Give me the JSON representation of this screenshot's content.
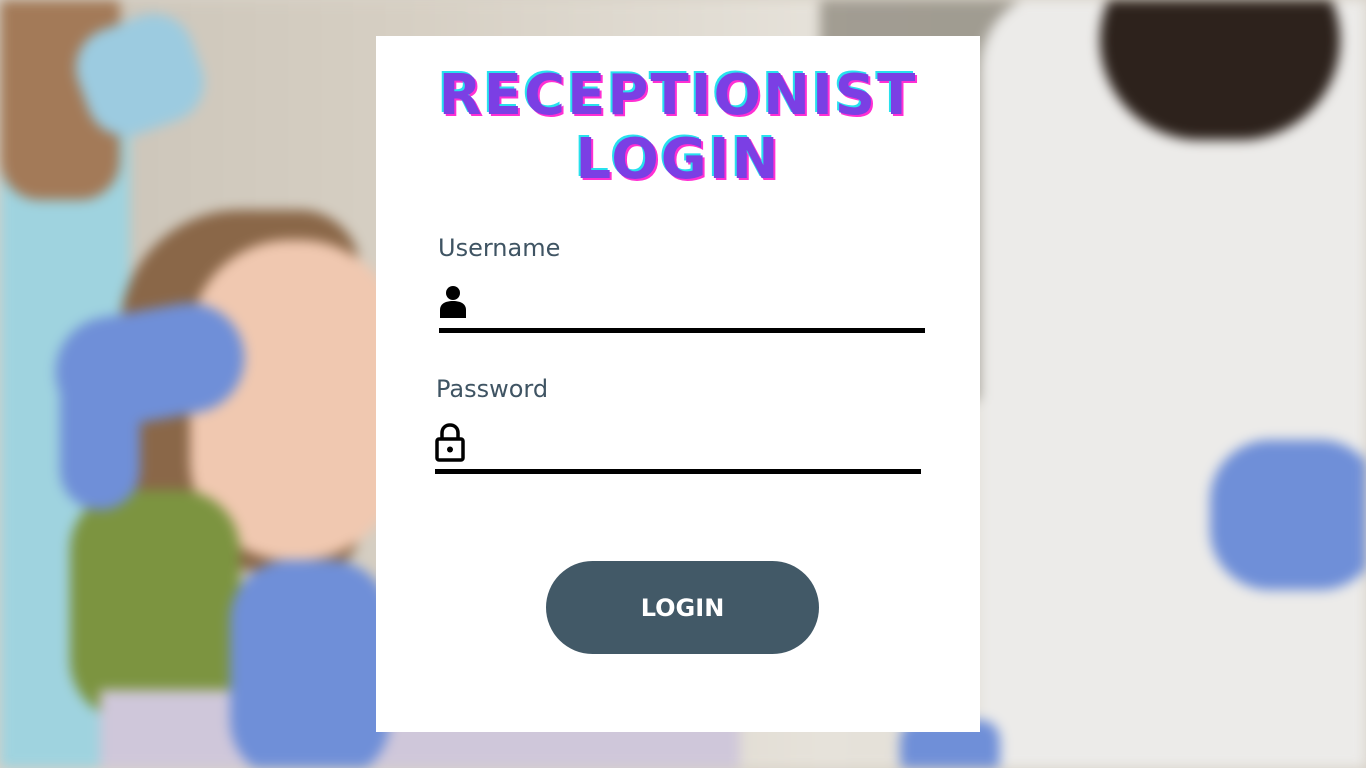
{
  "login": {
    "title_line1": "Receptionist",
    "title_line2": "Login",
    "username_label": "Username",
    "username_icon": "user-icon",
    "password_label": "Password",
    "password_icon": "lock-icon",
    "button_label": "LOGIN"
  },
  "colors": {
    "title": "#7b3fe4",
    "button": "#425967",
    "label": "#3f5463"
  }
}
